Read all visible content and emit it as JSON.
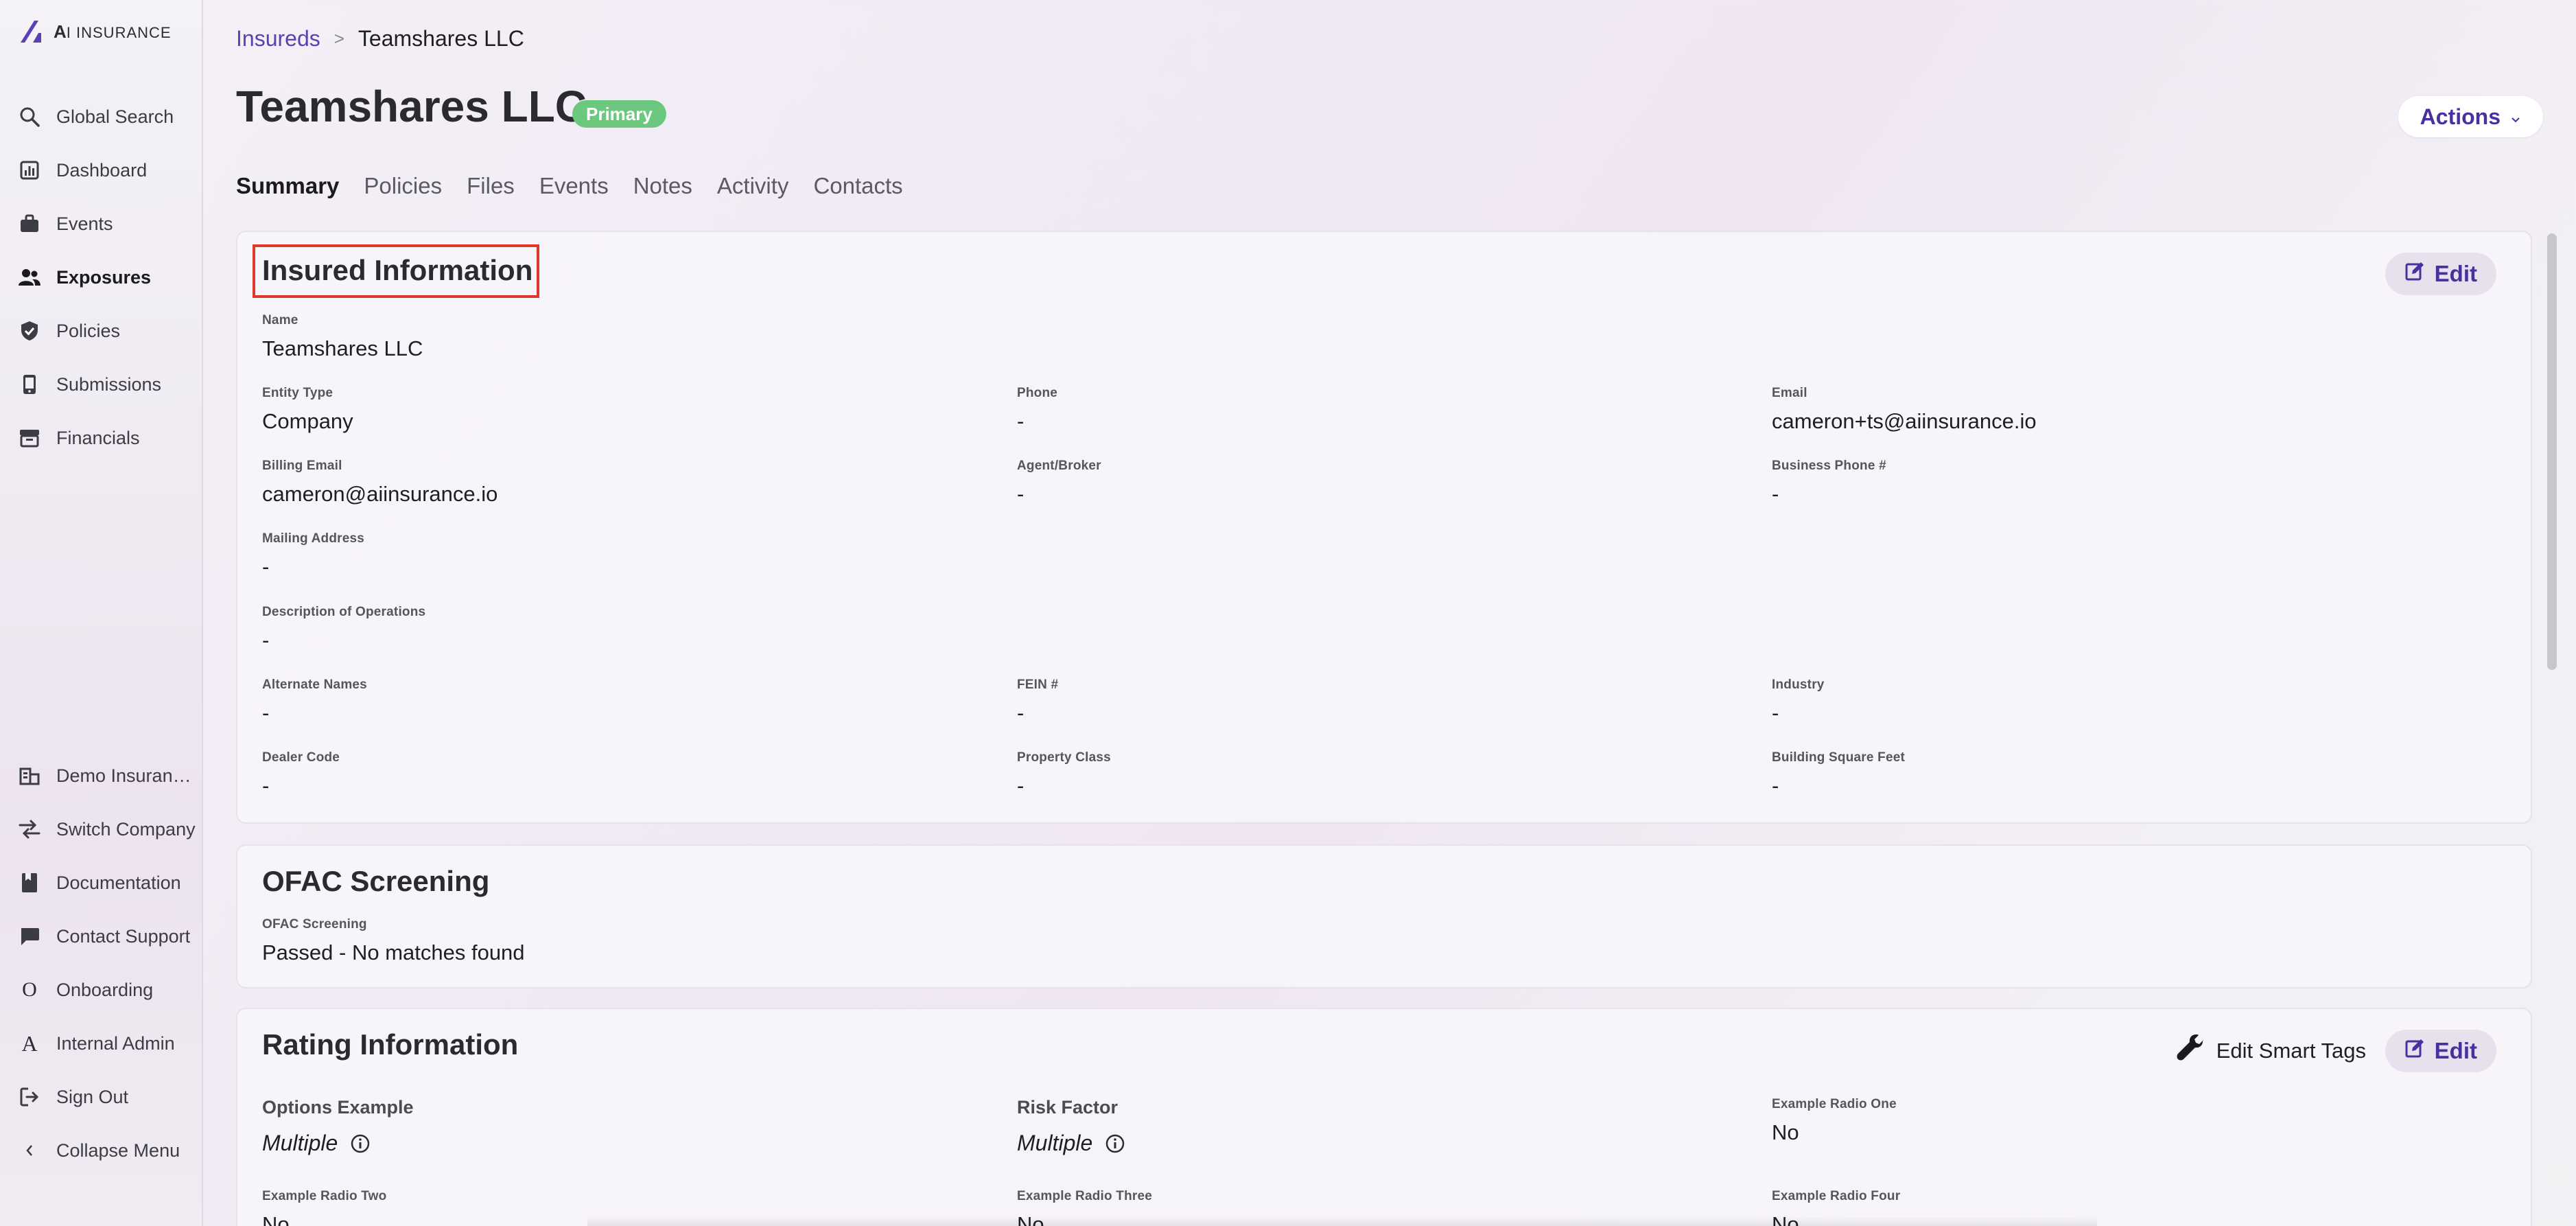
{
  "sidebar": {
    "logo": {
      "mark": "ai-slash-logo",
      "text_a": "A",
      "text_rest": "I INSURANCE"
    },
    "top_items": [
      {
        "label": "Global Search",
        "icon": "search-icon"
      },
      {
        "label": "Dashboard",
        "icon": "bar-chart-icon"
      },
      {
        "label": "Events",
        "icon": "briefcase-icon"
      },
      {
        "label": "Exposures",
        "icon": "people-icon",
        "active": true
      },
      {
        "label": "Policies",
        "icon": "shield-check-icon"
      },
      {
        "label": "Submissions",
        "icon": "phone-device-icon"
      },
      {
        "label": "Financials",
        "icon": "archive-box-icon"
      }
    ],
    "bottom_items": [
      {
        "label": "Demo Insurance Co",
        "icon": "building-icon"
      },
      {
        "label": "Switch Company",
        "icon": "swap-arrows-icon"
      },
      {
        "label": "Documentation",
        "icon": "book-icon"
      },
      {
        "label": "Contact Support",
        "icon": "chat-bubble-icon"
      },
      {
        "label": "Onboarding",
        "icon": "onboarding-o-icon"
      },
      {
        "label": "Internal Admin",
        "icon": "admin-a-icon"
      },
      {
        "label": "Sign Out",
        "icon": "sign-out-icon"
      },
      {
        "label": "Collapse Menu",
        "icon": "chevron-left-icon"
      }
    ]
  },
  "breadcrumb": {
    "parent": "Insureds",
    "separator": ">",
    "current": "Teamshares LLC"
  },
  "header": {
    "title": "Teamshares LLC",
    "badge": "Primary",
    "actions_label": "Actions"
  },
  "tabs": [
    "Summary",
    "Policies",
    "Files",
    "Events",
    "Notes",
    "Activity",
    "Contacts"
  ],
  "insured_info": {
    "title": "Insured Information",
    "edit_label": "Edit",
    "name": {
      "label": "Name",
      "value": "Teamshares LLC"
    },
    "entity_type": {
      "label": "Entity Type",
      "value": "Company"
    },
    "phone": {
      "label": "Phone",
      "value": "-"
    },
    "email": {
      "label": "Email",
      "value": "cameron+ts@aiinsurance.io"
    },
    "billing_email": {
      "label": "Billing Email",
      "value": "cameron@aiinsurance.io"
    },
    "agent_broker": {
      "label": "Agent/Broker",
      "value": "-"
    },
    "business_phone": {
      "label": "Business Phone #",
      "value": "-"
    },
    "mailing_address": {
      "label": "Mailing Address",
      "value": "-"
    },
    "description_ops": {
      "label": "Description of Operations",
      "value": "-"
    },
    "alternate_names": {
      "label": "Alternate Names",
      "value": "-"
    },
    "fein": {
      "label": "FEIN #",
      "value": "-"
    },
    "industry": {
      "label": "Industry",
      "value": "-"
    },
    "dealer_code": {
      "label": "Dealer Code",
      "value": "-"
    },
    "property_class": {
      "label": "Property Class",
      "value": "-"
    },
    "building_sqft": {
      "label": "Building Square Feet",
      "value": "-"
    }
  },
  "ofac": {
    "title": "OFAC Screening",
    "field": {
      "label": "OFAC Screening",
      "value": "Passed - No matches found"
    }
  },
  "rating": {
    "title": "Rating Information",
    "smart_tags_label": "Edit Smart Tags",
    "edit_label": "Edit",
    "options_example": {
      "label": "Options Example",
      "value": "Multiple"
    },
    "risk_factor": {
      "label": "Risk Factor",
      "value": "Multiple"
    },
    "radio_one": {
      "label": "Example Radio One",
      "value": "No"
    },
    "radio_two": {
      "label": "Example Radio Two",
      "value": "No"
    },
    "radio_three": {
      "label": "Example Radio Three",
      "value": "No"
    },
    "radio_four": {
      "label": "Example Radio Four",
      "value": "No"
    }
  },
  "colors": {
    "accent": "#5b3fb3",
    "badge": "#6cc77f",
    "highlight": "#e0392b"
  }
}
